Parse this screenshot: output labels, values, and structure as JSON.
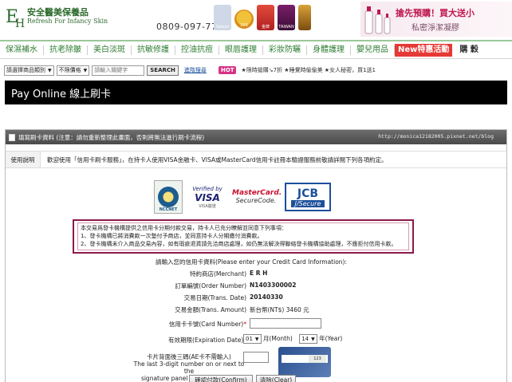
{
  "header": {
    "brand_cn": "安全醫美保養品",
    "brand_en": "Refresh For Infancy Skin",
    "phone": "0809-097-778",
    "badges": [
      "Taiwan",
      "100",
      "金牌",
      "TAIWAN",
      ""
    ],
    "promo_title": "搶先預購！買大送小",
    "promo_sub": "私密淨潔凝膠"
  },
  "nav": {
    "items": [
      "保濕補水",
      "抗老除皺",
      "美白淡斑",
      "抗敏修護",
      "控油抗痘",
      "眼唇護理",
      "彩妝防曬",
      "身體護理",
      "嬰兒用品"
    ],
    "new_item": "New特惠活動",
    "last_item": "購 穀"
  },
  "search": {
    "category_select": "請選擇商品類別",
    "price_select": "不限價格",
    "keyword_placeholder": "請輸入關鍵字",
    "search_button": "SEARCH",
    "advanced_link": "進階搜尋",
    "hot_label": "HOT",
    "hot_text": "★限時搶購↘7折  ★睡覺時偷偷美  ★女人秘密，買1送1"
  },
  "banner": {
    "title": "Pay Online 線上刷卡"
  },
  "panel": {
    "heading": "填寫刷卡資料 (注意：請勿重新整理此畫面，否則將無法進行刷卡流程)",
    "url": "http://monica12182005.pixnet.net/blog",
    "usage_label": "使用說明",
    "usage_text": "歡迎使用「信用卡刷卡服務」，在持卡人使用VISA金融卡、VISA或MasterCard信用卡註冊本驗證服務前敬請詳閱下列各項約定。",
    "logos": {
      "ncc": "NCCNET",
      "visa_top": "Verified by",
      "visa_main": "VISA",
      "visa_sub": "VISA驗證",
      "mc_top": "MasterCard.",
      "mc_sub": "SecureCode.",
      "jcb_top": "JCB",
      "jcb_sub": "J/Secure"
    },
    "notice_lines": [
      "本交易爲發卡機構提供之信用卡分期付款交易，持卡人已充分瞭解並同意下列事項：",
      "1、發卡機構已將消費款一次墊付予商店，並同意持卡人分期繳付消費款。",
      "2、發卡機構未介入商品交易內容，如有瑕疵退貨請先洽商店處理，如仍無法解決得聯絡發卡機構協助處理，不應拒付信用卡款。"
    ]
  },
  "form": {
    "intro": "請輸入您的信用卡資料(Please enter your Credit Card Information):",
    "merchant_label": "特約商店(Merchant)",
    "merchant_value": "E R H",
    "order_label": "訂單編號(Order Number)",
    "order_value": "N1403300002",
    "date_label": "交易日期(Trans. Date)",
    "date_value": "20140330",
    "amount_label": "交易金額(Trans. Amount)",
    "amount_value": "新台幣(NT$) 3460 元",
    "card_label": "信用卡卡號(Card Number)",
    "required_mark": "*",
    "expiry_label": "有效期限(Expiration Date)",
    "month_value": "01",
    "month_unit": "月(Month)",
    "year_value": "14",
    "year_unit": "年(Year)",
    "cvv_line1": "卡片背面後三碼(AE卡不需輸入)",
    "cvv_line2": "The last 3-digit number on or next to the",
    "cvv_line3": "signature panel (No need for AE Card)",
    "card_cvv_sample": "123",
    "confirm_button": "確認付款(Confirm)",
    "clear_button": "清除(Clear)"
  }
}
